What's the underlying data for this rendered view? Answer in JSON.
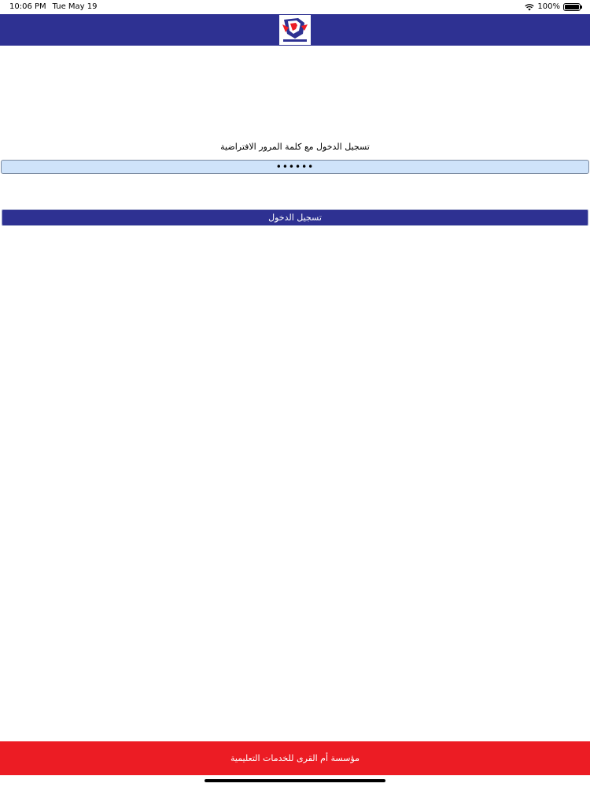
{
  "status_bar": {
    "time": "10:06 PM",
    "date": "Tue May 19",
    "battery": "100%",
    "battery_level": 1.0
  },
  "header": {
    "logo_icon": "school-shield-logo",
    "colors": {
      "bar": "#2e3192"
    }
  },
  "login": {
    "label": "تسجيل الدخول مع كلمة المرور الافتراضية",
    "password_value": "••••••",
    "button_label": "تسجيل الدخول"
  },
  "footer": {
    "text": "مؤسسة أم القرى للخدمات التعليمية",
    "color": "#ec1c24"
  }
}
